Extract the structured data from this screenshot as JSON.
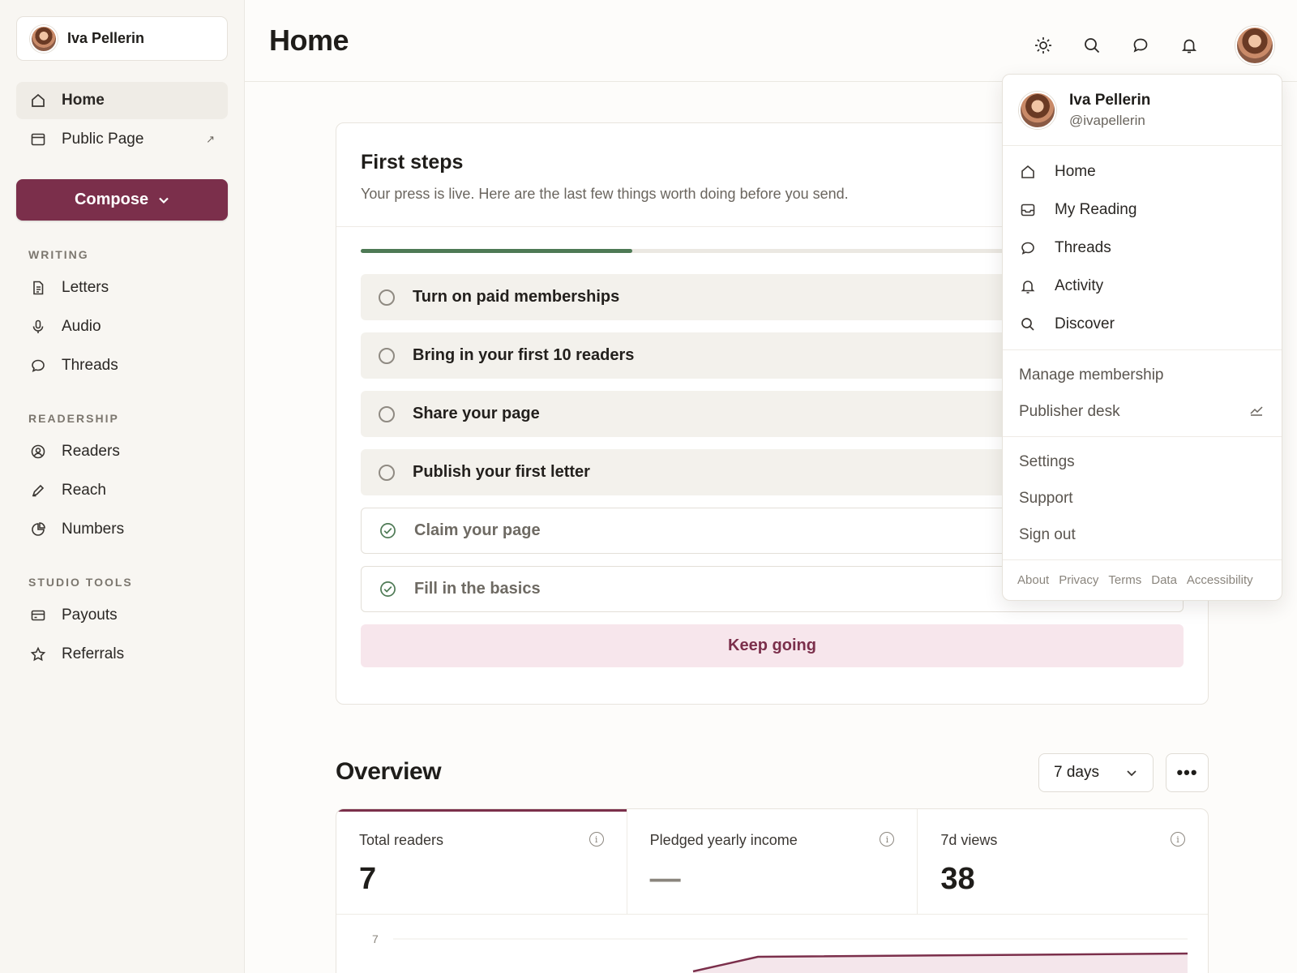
{
  "account": {
    "name": "Iva Pellerin"
  },
  "sidebar": {
    "primary": [
      {
        "label": "Home",
        "icon": "home-icon"
      },
      {
        "label": "Public Page",
        "icon": "page-icon",
        "trail": "↗"
      }
    ],
    "compose_label": "Compose",
    "sections": [
      {
        "label": "WRITING",
        "items": [
          {
            "label": "Letters",
            "icon": "document-icon"
          },
          {
            "label": "Audio",
            "icon": "microphone-icon"
          },
          {
            "label": "Threads",
            "icon": "chat-icon"
          }
        ]
      },
      {
        "label": "READERSHIP",
        "items": [
          {
            "label": "Readers",
            "icon": "user-circle-icon"
          },
          {
            "label": "Reach",
            "icon": "pen-icon"
          },
          {
            "label": "Numbers",
            "icon": "pie-icon"
          }
        ]
      },
      {
        "label": "STUDIO TOOLS",
        "items": [
          {
            "label": "Payouts",
            "icon": "card-icon"
          },
          {
            "label": "Referrals",
            "icon": "star-icon"
          }
        ]
      }
    ]
  },
  "header": {
    "title": "Home"
  },
  "first_steps": {
    "title": "First steps",
    "subtitle": "Your press is live. Here are the last few things worth doing before you send.",
    "progress": 0.33,
    "steps": [
      {
        "label": "Turn on paid memberships",
        "done": false
      },
      {
        "label": "Bring in your first 10 readers",
        "done": false
      },
      {
        "label": "Share your page",
        "done": false
      },
      {
        "label": "Publish your first letter",
        "done": false
      },
      {
        "label": "Claim your page",
        "done": true
      },
      {
        "label": "Fill in the basics",
        "done": true
      }
    ],
    "cta": "Keep going"
  },
  "overview": {
    "title": "Overview",
    "range": "7 days",
    "more": "•••",
    "stats": [
      {
        "label": "Total readers",
        "value": "7"
      },
      {
        "label": "Pledged yearly income",
        "value": "—"
      },
      {
        "label": "7d views",
        "value": "38"
      }
    ],
    "chart_y_label": "7"
  },
  "menu": {
    "name": "Iva Pellerin",
    "handle": "@ivapellerin",
    "nav": [
      {
        "label": "Home",
        "icon": "home-icon"
      },
      {
        "label": "My Reading",
        "icon": "inbox-icon"
      },
      {
        "label": "Threads",
        "icon": "chat-icon"
      },
      {
        "label": "Activity",
        "icon": "bell-icon"
      },
      {
        "label": "Discover",
        "icon": "search-icon"
      }
    ],
    "manage": "Manage membership",
    "publisher": "Publisher desk",
    "settings": "Settings",
    "support": "Support",
    "signout": "Sign out",
    "footer": [
      "About",
      "Privacy",
      "Terms",
      "Data",
      "Accessibility"
    ]
  },
  "colors": {
    "accent": "#7b2f4b",
    "progress": "#4e7a55",
    "cta_bg": "#f7e6ec"
  }
}
